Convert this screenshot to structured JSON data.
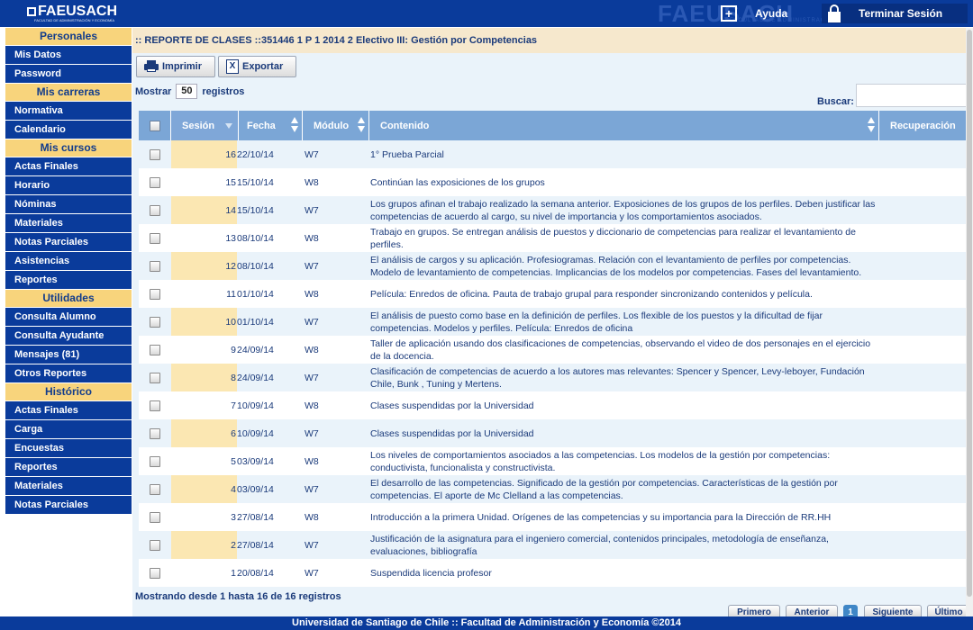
{
  "header": {
    "logo": "FAEUSACH",
    "logo_sub": "FACULTAD DE ADMINISTRACIÓN Y ECONOMÍA",
    "watermark": "FAEUSACH",
    "watermark_sub": "FACULTAD DE ADMINISTRACIÓN",
    "help_label": "Ayuda",
    "logout_label": "Terminar Sesión",
    "color": "#0a3b9b"
  },
  "sidebar": {
    "sections": [
      {
        "title": "Personales",
        "items": [
          "Mis Datos",
          "Password"
        ]
      },
      {
        "title": "Mis carreras",
        "items": [
          "Normativa",
          "Calendario"
        ]
      },
      {
        "title": "Mis cursos",
        "items": [
          "Actas Finales",
          "Horario",
          "Nóminas",
          "Materiales",
          "Notas Parciales",
          "Asistencias",
          "Reportes"
        ]
      },
      {
        "title": "Utilidades",
        "items": [
          "Consulta Alumno",
          "Consulta Ayudante",
          "Mensajes (81)",
          "Otros Reportes"
        ]
      },
      {
        "title": "Histórico",
        "items": [
          "Actas Finales",
          "Carga",
          "Encuestas",
          "Reportes",
          "Materiales",
          "Notas Parciales"
        ]
      }
    ]
  },
  "main": {
    "breadcrumb": ":: REPORTE DE CLASES ::351446 1 P 1 2014 2 Electivo III: Gestión por Competencias",
    "print_label": "Imprimir",
    "export_label": "Exportar",
    "length_prefix": "Mostrar",
    "length_value": "50",
    "length_suffix": "registros",
    "search_label": "Buscar:",
    "search_value": "",
    "columns": [
      "",
      "Sesión",
      "Fecha",
      "Módulo",
      "Contenido",
      "Recuperación"
    ],
    "rows": [
      {
        "sesion": "16",
        "fecha": "22/10/14",
        "modulo": "W7",
        "contenido": "1° Prueba Parcial",
        "recuperacion": ""
      },
      {
        "sesion": "15",
        "fecha": "15/10/14",
        "modulo": "W8",
        "contenido": "Continúan las exposiciones de los grupos",
        "recuperacion": ""
      },
      {
        "sesion": "14",
        "fecha": "15/10/14",
        "modulo": "W7",
        "contenido": "Los grupos afinan el trabajo realizado la semana anterior. Exposiciones de los grupos de los perfiles. Deben justificar las competencias de acuerdo al cargo, su nivel de importancia y los comportamientos asociados.",
        "recuperacion": ""
      },
      {
        "sesion": "13",
        "fecha": "08/10/14",
        "modulo": "W8",
        "contenido": "Trabajo en grupos. Se entregan análisis de puestos y diccionario de competencias para realizar el levantamiento de perfiles.",
        "recuperacion": ""
      },
      {
        "sesion": "12",
        "fecha": "08/10/14",
        "modulo": "W7",
        "contenido": "El análisis de cargos y su aplicación. Profesiogramas. Relación con el levantamiento de perfiles por competencias. Modelo de levantamiento de competencias. Implicancias de los modelos por competencias. Fases del levantamiento.",
        "recuperacion": ""
      },
      {
        "sesion": "11",
        "fecha": "01/10/14",
        "modulo": "W8",
        "contenido": "Película: Enredos de oficina. Pauta de trabajo grupal para responder sincronizando contenidos y película.",
        "recuperacion": ""
      },
      {
        "sesion": "10",
        "fecha": "01/10/14",
        "modulo": "W7",
        "contenido": "El análisis de puesto como base en la definición de perfiles. Los flexible de los puestos y la dificultad de fijar competencias. Modelos y perfiles. Película: Enredos de oficina",
        "recuperacion": ""
      },
      {
        "sesion": "9",
        "fecha": "24/09/14",
        "modulo": "W8",
        "contenido": "Taller de aplicación usando dos clasificaciones de competencias, observando el video de dos personajes en el ejercicio de la docencia.",
        "recuperacion": ""
      },
      {
        "sesion": "8",
        "fecha": "24/09/14",
        "modulo": "W7",
        "contenido": "Clasificación de competencias de acuerdo a los autores mas relevantes: Spencer y Spencer, Levy-leboyer, Fundación Chile, Bunk , Tuning y Mertens.",
        "recuperacion": ""
      },
      {
        "sesion": "7",
        "fecha": "10/09/14",
        "modulo": "W8",
        "contenido": "Clases suspendidas por la Universidad",
        "recuperacion": ""
      },
      {
        "sesion": "6",
        "fecha": "10/09/14",
        "modulo": "W7",
        "contenido": "Clases suspendidas por la Universidad",
        "recuperacion": ""
      },
      {
        "sesion": "5",
        "fecha": "03/09/14",
        "modulo": "W8",
        "contenido": "Los niveles de comportamientos asociados a las competencias. Los modelos de la gestión por competencias: conductivista, funcionalista y constructivista.",
        "recuperacion": ""
      },
      {
        "sesion": "4",
        "fecha": "03/09/14",
        "modulo": "W7",
        "contenido": "El desarrollo de las competencias. Significado de la gestión por competencias. Características de la gestión por competencias. El aporte de Mc Clelland a las competencias.",
        "recuperacion": ""
      },
      {
        "sesion": "3",
        "fecha": "27/08/14",
        "modulo": "W8",
        "contenido": "Introducción a la primera Unidad. Orígenes de las competencias y su importancia para la Dirección de RR.HH",
        "recuperacion": ""
      },
      {
        "sesion": "2",
        "fecha": "27/08/14",
        "modulo": "W7",
        "contenido": "Justificación de la asignatura para el ingeniero comercial, contenidos principales, metodología de enseñanza, evaluaciones, bibliografía",
        "recuperacion": ""
      },
      {
        "sesion": "1",
        "fecha": "20/08/14",
        "modulo": "W7",
        "contenido": "Suspendida licencia profesor",
        "recuperacion": ""
      }
    ],
    "info": "Mostrando desde 1 hasta 16 de 16 registros",
    "pager": [
      "Primero",
      "Anterior",
      "1",
      "Siguiente",
      "Último"
    ]
  },
  "footer": {
    "text": "Universidad de Santiago de Chile :: Facultad de Administración y Economía ©2014"
  }
}
